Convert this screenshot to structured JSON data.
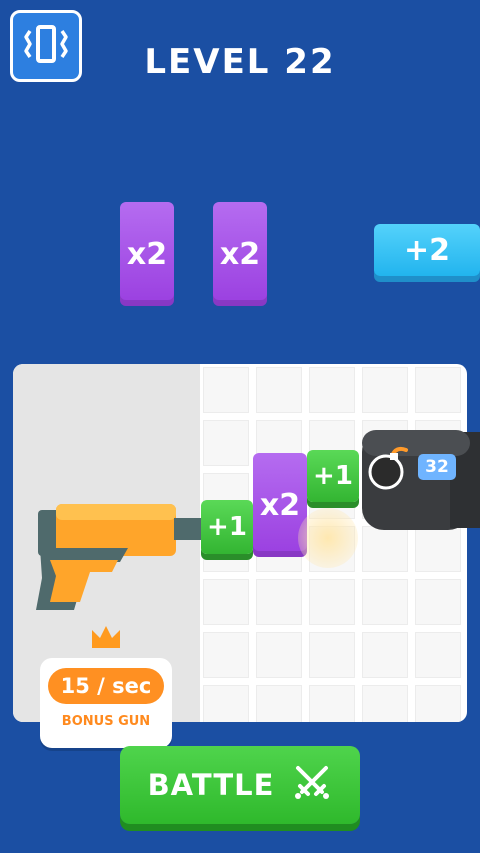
{
  "header": {
    "level_title": "LEVEL 22"
  },
  "gates": {
    "top_left": "x2",
    "top_mid": "x2",
    "top_right": "+2",
    "board_plus_one_a": "+1",
    "board_x2": "x2",
    "board_plus_one_b": "+1"
  },
  "enemy": {
    "bomb_count": "32"
  },
  "bonus": {
    "rate": "15 / sec",
    "label": "BONUS GUN"
  },
  "actions": {
    "battle_label": "BATTLE"
  },
  "colors": {
    "background": "#1b4fa3",
    "gate_purple": "#a24ee6",
    "gate_cyan": "#36c2f5",
    "gate_green": "#3fc03c",
    "battle_green": "#3ec33b",
    "bonus_orange": "#ff9022"
  },
  "icons": [
    "vibration-icon",
    "crown-icon",
    "bomb-icon",
    "crossed-swords-icon"
  ]
}
